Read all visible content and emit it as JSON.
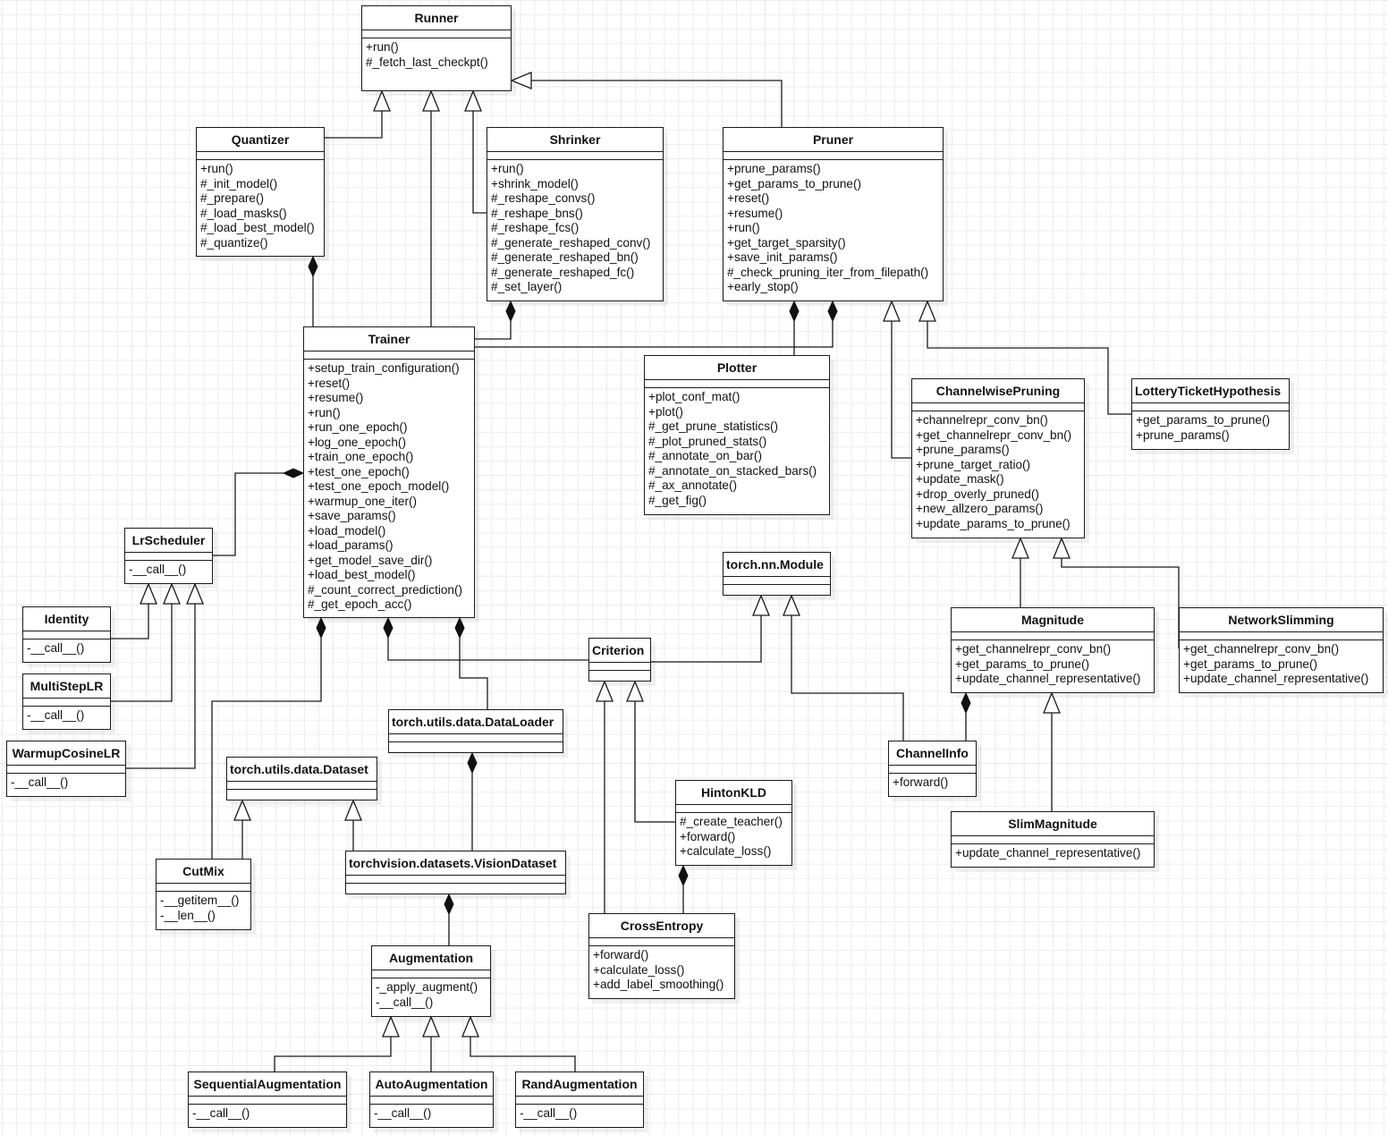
{
  "diagram": {
    "type": "UML class diagram",
    "classes": [
      {
        "id": "runner",
        "name": "Runner",
        "methods": [
          "+run()",
          "#_fetch_last_checkpt()"
        ]
      },
      {
        "id": "quantizer",
        "name": "Quantizer",
        "methods": [
          "+run()",
          "#_init_model()",
          "#_prepare()",
          "#_load_masks()",
          "#_load_best_model()",
          "#_quantize()"
        ]
      },
      {
        "id": "shrinker",
        "name": "Shrinker",
        "methods": [
          "+run()",
          "+shrink_model()",
          "#_reshape_convs()",
          "#_reshape_bns()",
          "#_reshape_fcs()",
          "#_generate_reshaped_conv()",
          "#_generate_reshaped_bn()",
          "#_generate_reshaped_fc()",
          "#_set_layer()"
        ]
      },
      {
        "id": "pruner",
        "name": "Pruner",
        "methods": [
          "+prune_params()",
          "+get_params_to_prune()",
          "+reset()",
          "+resume()",
          "+run()",
          "+get_target_sparsity()",
          "+save_init_params()",
          "#_check_pruning_iter_from_filepath()",
          "+early_stop()"
        ]
      },
      {
        "id": "trainer",
        "name": "Trainer",
        "methods": [
          "+setup_train_configuration()",
          "+reset()",
          "+resume()",
          "+run()",
          "+run_one_epoch()",
          "+log_one_epoch()",
          "+train_one_epoch()",
          "+test_one_epoch()",
          "+test_one_epoch_model()",
          "+warmup_one_iter()",
          "+save_params()",
          "+load_model()",
          "+load_params()",
          "+get_model_save_dir()",
          "+load_best_model()",
          "#_count_correct_prediction()",
          "#_get_epoch_acc()"
        ]
      },
      {
        "id": "plotter",
        "name": "Plotter",
        "methods": [
          "+plot_conf_mat()",
          "+plot()",
          "#_get_prune_statistics()",
          "#_plot_pruned_stats()",
          "#_annotate_on_bar()",
          "#_annotate_on_stacked_bars()",
          "#_ax_annotate()",
          "#_get_fig()"
        ]
      },
      {
        "id": "channelwise",
        "name": "ChannelwisePruning",
        "methods": [
          "+channelrepr_conv_bn()",
          "+get_channelrepr_conv_bn()",
          "+prune_params()",
          "+prune_target_ratio()",
          "+update_mask()",
          "+drop_overly_pruned()",
          "+new_allzero_params()",
          "+update_params_to_prune()"
        ]
      },
      {
        "id": "lottery",
        "name": "LotteryTicketHypothesis",
        "methods": [
          "+get_params_to_prune()",
          "+prune_params()"
        ]
      },
      {
        "id": "lrscheduler",
        "name": "LrScheduler",
        "methods": [
          "-__call__()"
        ]
      },
      {
        "id": "identity",
        "name": "Identity",
        "methods": [
          "-__call__()"
        ]
      },
      {
        "id": "multisteplr",
        "name": "MultiStepLR",
        "methods": [
          "-__call__()"
        ]
      },
      {
        "id": "warmupcosinelr",
        "name": "WarmupCosineLR",
        "methods": [
          "-__call__()"
        ]
      },
      {
        "id": "nnmodule",
        "name": "torch.nn.Module",
        "methods": []
      },
      {
        "id": "criterion",
        "name": "Criterion",
        "methods": []
      },
      {
        "id": "magnitude",
        "name": "Magnitude",
        "methods": [
          "+get_channelrepr_conv_bn()",
          "+get_params_to_prune()",
          "+update_channel_representative()"
        ]
      },
      {
        "id": "networkslimming",
        "name": "NetworkSlimming",
        "methods": [
          "+get_channelrepr_conv_bn()",
          "+get_params_to_prune()",
          "+update_channel_representative()"
        ]
      },
      {
        "id": "dataloader",
        "name": "torch.utils.data.DataLoader",
        "methods": []
      },
      {
        "id": "dataset",
        "name": "torch.utils.data.Dataset",
        "methods": []
      },
      {
        "id": "channelinfo",
        "name": "ChannelInfo",
        "methods": [
          "+forward()"
        ]
      },
      {
        "id": "hintonkld",
        "name": "HintonKLD",
        "methods": [
          "#_create_teacher()",
          "+forward()",
          "+calculate_loss()"
        ]
      },
      {
        "id": "cutmix",
        "name": "CutMix",
        "methods": [
          "-__getitem__()",
          "-__len__()"
        ]
      },
      {
        "id": "visiondataset",
        "name": "torchvision.datasets.VisionDataset",
        "methods": []
      },
      {
        "id": "slimmagnitude",
        "name": "SlimMagnitude",
        "methods": [
          "+update_channel_representative()"
        ]
      },
      {
        "id": "crossentropy",
        "name": "CrossEntropy",
        "methods": [
          "+forward()",
          "+calculate_loss()",
          "+add_label_smoothing()"
        ]
      },
      {
        "id": "augmentation",
        "name": "Augmentation",
        "methods": [
          "-_apply_augment()",
          "-__call__()"
        ]
      },
      {
        "id": "sequentialaug",
        "name": "SequentialAugmentation",
        "methods": [
          "-__call__()"
        ]
      },
      {
        "id": "autoaug",
        "name": "AutoAugmentation",
        "methods": [
          "-__call__()"
        ]
      },
      {
        "id": "randaug",
        "name": "RandAugmentation",
        "methods": [
          "-__call__()"
        ]
      }
    ],
    "relations": [
      {
        "kind": "inheritance",
        "from": "Quantizer",
        "to": "Runner"
      },
      {
        "kind": "inheritance",
        "from": "Trainer",
        "to": "Runner"
      },
      {
        "kind": "inheritance",
        "from": "Shrinker",
        "to": "Runner"
      },
      {
        "kind": "inheritance",
        "from": "Pruner",
        "to": "Runner"
      },
      {
        "kind": "composition",
        "from": "Trainer",
        "to": "Quantizer"
      },
      {
        "kind": "composition",
        "from": "Trainer",
        "to": "Shrinker"
      },
      {
        "kind": "composition",
        "from": "Plotter",
        "to": "Pruner"
      },
      {
        "kind": "composition",
        "from": "Trainer",
        "to": "Pruner"
      },
      {
        "kind": "inheritance",
        "from": "ChannelwisePruning",
        "to": "Pruner"
      },
      {
        "kind": "inheritance",
        "from": "LotteryTicketHypothesis",
        "to": "Pruner"
      },
      {
        "kind": "composition",
        "from": "LrScheduler",
        "to": "Trainer"
      },
      {
        "kind": "inheritance",
        "from": "Identity",
        "to": "LrScheduler"
      },
      {
        "kind": "inheritance",
        "from": "MultiStepLR",
        "to": "LrScheduler"
      },
      {
        "kind": "inheritance",
        "from": "WarmupCosineLR",
        "to": "LrScheduler"
      },
      {
        "kind": "composition",
        "from": "CutMix",
        "to": "Trainer"
      },
      {
        "kind": "composition",
        "from": "Criterion",
        "to": "Trainer"
      },
      {
        "kind": "composition",
        "from": "torch.utils.data.DataLoader",
        "to": "Trainer"
      },
      {
        "kind": "inheritance",
        "from": "Criterion",
        "to": "torch.nn.Module"
      },
      {
        "kind": "inheritance",
        "from": "ChannelInfo",
        "to": "torch.nn.Module"
      },
      {
        "kind": "inheritance",
        "from": "Magnitude",
        "to": "ChannelwisePruning"
      },
      {
        "kind": "inheritance",
        "from": "NetworkSlimming",
        "to": "ChannelwisePruning"
      },
      {
        "kind": "composition",
        "from": "ChannelInfo",
        "to": "Magnitude"
      },
      {
        "kind": "inheritance",
        "from": "SlimMagnitude",
        "to": "Magnitude"
      },
      {
        "kind": "inheritance",
        "from": "CrossEntropy",
        "to": "Criterion"
      },
      {
        "kind": "inheritance",
        "from": "HintonKLD",
        "to": "Criterion"
      },
      {
        "kind": "composition",
        "from": "CrossEntropy",
        "to": "HintonKLD"
      },
      {
        "kind": "inheritance",
        "from": "CutMix",
        "to": "torch.utils.data.Dataset"
      },
      {
        "kind": "inheritance",
        "from": "torchvision.datasets.VisionDataset",
        "to": "torch.utils.data.Dataset"
      },
      {
        "kind": "composition",
        "from": "torchvision.datasets.VisionDataset",
        "to": "torch.utils.data.DataLoader"
      },
      {
        "kind": "composition",
        "from": "Augmentation",
        "to": "torchvision.datasets.VisionDataset"
      },
      {
        "kind": "inheritance",
        "from": "SequentialAugmentation",
        "to": "Augmentation"
      },
      {
        "kind": "inheritance",
        "from": "AutoAugmentation",
        "to": "Augmentation"
      },
      {
        "kind": "inheritance",
        "from": "RandAugmentation",
        "to": "Augmentation"
      }
    ]
  }
}
